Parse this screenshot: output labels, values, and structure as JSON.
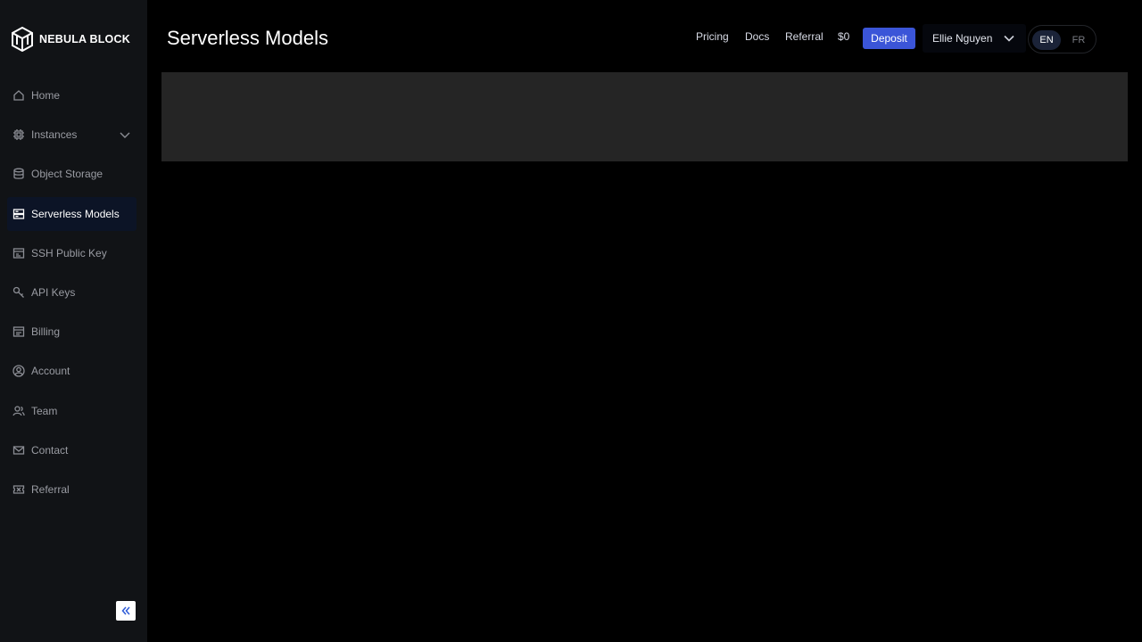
{
  "brand": {
    "name": "NEBULA BLOCK"
  },
  "sidebar": {
    "items": [
      {
        "label": "Home",
        "icon": "home-icon"
      },
      {
        "label": "Instances",
        "icon": "chip-icon"
      },
      {
        "label": "Object Storage",
        "icon": "database-icon"
      },
      {
        "label": "Serverless Models",
        "icon": "server-icon",
        "active": true
      },
      {
        "label": "SSH Public Key",
        "icon": "ssh-key-icon"
      },
      {
        "label": "API Keys",
        "icon": "key-icon"
      },
      {
        "label": "Billing",
        "icon": "billing-icon"
      },
      {
        "label": "Account",
        "icon": "account-icon"
      },
      {
        "label": "Team",
        "icon": "team-icon"
      },
      {
        "label": "Contact",
        "icon": "mail-icon"
      },
      {
        "label": "Referral",
        "icon": "ticket-icon"
      }
    ]
  },
  "header": {
    "title": "Serverless Models",
    "nav": {
      "pricing": "Pricing",
      "docs": "Docs",
      "referral": "Referral",
      "balance": "$0"
    },
    "deposit_label": "Deposit",
    "user_name": "Ellie Nguyen",
    "languages": {
      "en": "EN",
      "fr": "FR",
      "selected": "EN"
    }
  },
  "colors": {
    "accent": "#3b55d8",
    "background": "#000000",
    "sidebar": "#111316",
    "panel": "#252525"
  }
}
